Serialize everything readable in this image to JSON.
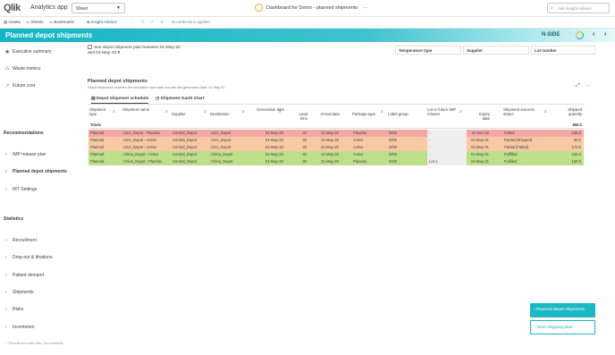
{
  "topbar": {
    "logo": "Qlik",
    "app_title": "Analytics app",
    "sheet_label": "Sheet",
    "center_title": "Dashboard for Demo - planned shipments",
    "more": "···",
    "search_placeholder": "Ask Insight Advisor"
  },
  "toolbar": {
    "assets": "Assets",
    "sheets": "Sheets",
    "bookmarks": "Bookmarks",
    "insight": "Insight Advisor",
    "selections": "No selections applied"
  },
  "banner": {
    "title": "Planned depot shipments",
    "brand": "N-SIDE",
    "prev": "‹",
    "next": "›"
  },
  "sidebar": {
    "top_items": [
      {
        "label": "Executive summary",
        "icon": "eye-icon",
        "glyph": "◉"
      },
      {
        "label": "Waste metrics",
        "icon": "recycle-icon",
        "glyph": "♺"
      },
      {
        "label": "Future cost",
        "icon": "trend-icon",
        "glyph": "↗"
      }
    ],
    "recommendations_heading": "Recommendations",
    "recommendations": [
      {
        "label": "IMP release plan",
        "active": false
      },
      {
        "label": "Planned depot shipments",
        "active": true
      },
      {
        "label": "IRT Settings",
        "active": false
      }
    ],
    "statistics_heading": "Statistics",
    "statistics": [
      {
        "label": "Recruitment"
      },
      {
        "label": "Drop-out & titrations"
      },
      {
        "label": "Patient demand"
      },
      {
        "label": "Shipments"
      },
      {
        "label": "Risks"
      },
      {
        "label": "Inventories"
      }
    ],
    "footer": "Recruitment start date: Not available"
  },
  "filters": {
    "checkbox_label": "See depot shipment plan between 01-May-20 and 01-May-20",
    "temperature": "Temperature type",
    "supplier": "Supplier",
    "lot": "Lot number"
  },
  "panel": {
    "title": "Planned depot shipments",
    "subtitle": "Depot shipments between the simulation start date and the last generation date: 01 May 20",
    "tabs": [
      "Depot shipment schedule",
      "Shipment Gantt chart"
    ]
  },
  "table": {
    "headers": [
      "Shipment type",
      "Shipment name",
      "Supplier",
      "Destination",
      "Generation date",
      "Lead time",
      "Arrival date",
      "Package type",
      "Label group",
      "Lot or future IMP release",
      "Expiry date",
      "Shipment success status",
      "Shipped quantity"
    ],
    "totals_label": "Totals",
    "totals_value": "865.0",
    "rows": [
      [
        "Planned",
        "USA_Depot - Placebo",
        "Central_Depot",
        "USA_Depot",
        "01-May-20",
        "30",
        "31-May-20",
        "Placebo",
        "W/W",
        "-",
        "31-Dec-22",
        "Failed",
        "245.0"
      ],
      [
        "Planned",
        "USA_Depot - Active",
        "Central_Depot",
        "USA_Depot",
        "01-May-20",
        "30",
        "31-May-20",
        "Active",
        "W/W",
        "-",
        "01-May-21",
        "Partial (Shipped)",
        "60.0"
      ],
      [
        "Planned",
        "USA_Depot - Active",
        "Central_Depot",
        "USA_Depot",
        "01-May-20",
        "30",
        "31-May-20",
        "Active",
        "W/W",
        "-",
        "01-May-21",
        "Partial (Failed)",
        "170.0"
      ],
      [
        "Planned",
        "China_Depot - Active",
        "Central_Depot",
        "China_Depot",
        "01-May-20",
        "30",
        "31-May-20",
        "Active",
        "W/W",
        "-",
        "01-May-21",
        "Fulfilled",
        "240.0"
      ],
      [
        "Planned",
        "China_Depot - Placebo",
        "Central_Depot",
        "China_Depot",
        "01-May-20",
        "30",
        "31-May-20",
        "Placebo",
        "W/W",
        "Lot 1",
        "01-May-21",
        "Fulfilled",
        "150.0"
      ]
    ],
    "row_colors": [
      "#f2a9a4",
      "#f8c9a3",
      "#f8c9a3",
      "#bedf8a",
      "#bedf8a"
    ]
  },
  "buttons": {
    "primary": "Planned depot shipments",
    "secondary": "Next shipping plan"
  }
}
